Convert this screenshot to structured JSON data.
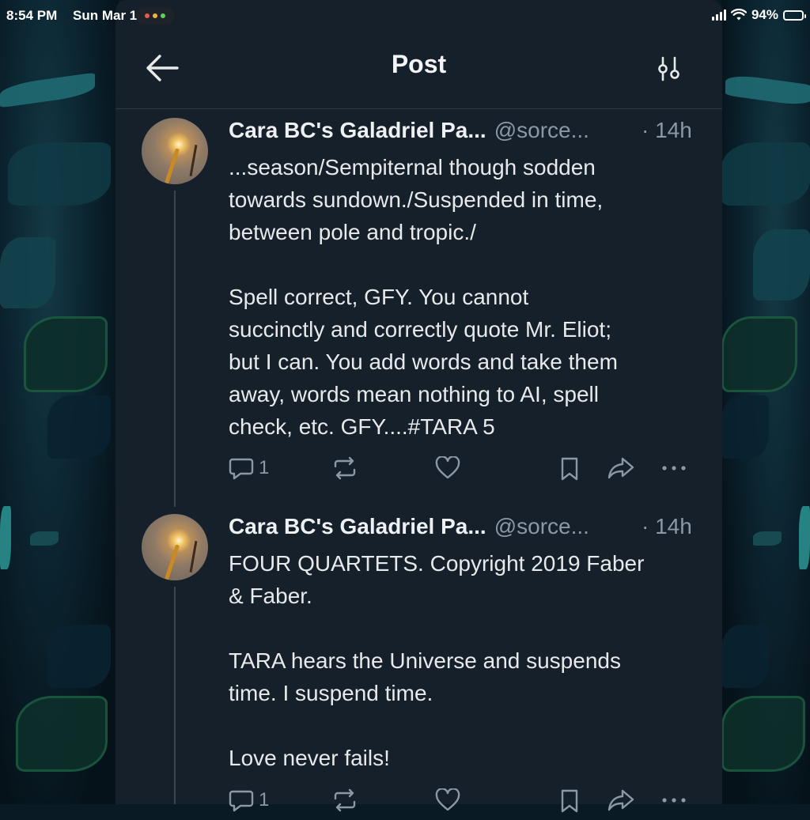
{
  "status_bar": {
    "time": "8:54 PM",
    "date": "Sun Mar 1",
    "battery": "94%",
    "battery_level": 0.94
  },
  "header": {
    "title": "Post",
    "back_icon": "arrow-left-icon",
    "filter_icon": "sliders-icon"
  },
  "posts": [
    {
      "author": "Cara BC's Galadriel Pa...",
      "handle": "@sorce...",
      "time": "· 14h",
      "text": "...season/Sempiternal though sodden\ntowards sundown./Suspended in time,\nbetween pole and tropic./\n\nSpell correct, GFY. You cannot\nsuccinctly and correctly quote Mr. Eliot;\nbut I can. You add words and take them\naway, words mean nothing to AI, spell\ncheck, etc. GFY....#TARA 5",
      "reply_count": "1"
    },
    {
      "author": "Cara BC's Galadriel Pa...",
      "handle": "@sorce...",
      "time": "· 14h",
      "text": "FOUR QUARTETS. Copyright 2019 Faber\n& Faber.\n\nTARA hears the Universe and suspends\ntime. I suspend time.\n\nLove never fails!",
      "reply_count": "1"
    }
  ],
  "colors": {
    "panel_bg": "#15202b",
    "muted": "#8b98a5",
    "text": "#e7e9ea"
  }
}
